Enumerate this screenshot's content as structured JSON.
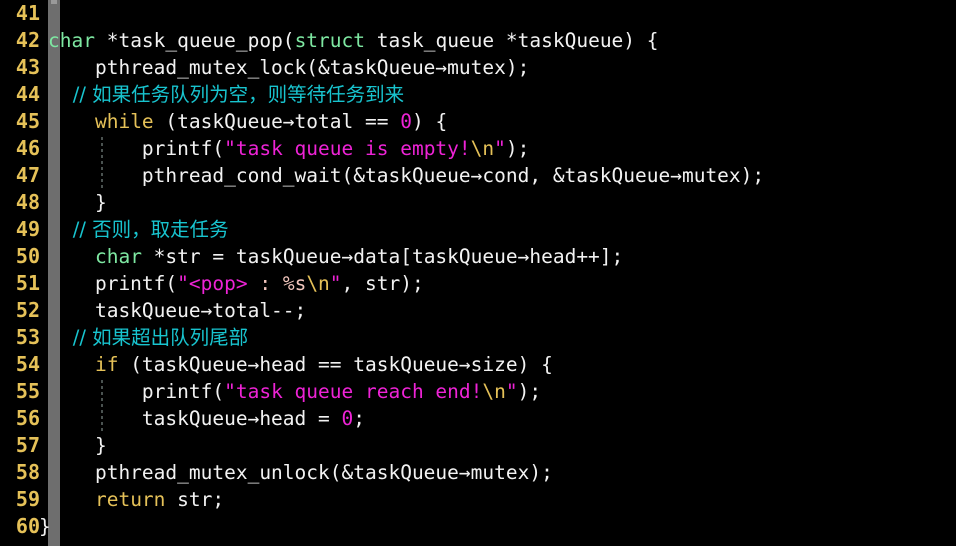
{
  "editor": {
    "background": "#000000",
    "first_line": 41,
    "last_line": 60,
    "gutter_color": "#e5c158",
    "scrollbar_color": "#6e6e6e",
    "colors": {
      "type_keyword": "#7ee8a2",
      "control_keyword": "#e5c158",
      "string": "#ee23d6",
      "escape": "#e5c158",
      "format_spec": "#f2c6bd",
      "number": "#ee23d6",
      "comment": "#18c4cf",
      "plain_text": "#f2f2f2"
    }
  },
  "line_numbers": [
    "41",
    "42",
    "43",
    "44",
    "45",
    "46",
    "47",
    "48",
    "49",
    "50",
    "51",
    "52",
    "53",
    "54",
    "55",
    "56",
    "57",
    "58",
    "59",
    "60"
  ],
  "code_lines": [
    {
      "num": "41",
      "text": ""
    },
    {
      "num": "42",
      "text": "char *task_queue_pop(struct task_queue *taskQueue) {"
    },
    {
      "num": "43",
      "text": "    pthread_mutex_lock(&taskQueue->mutex);"
    },
    {
      "num": "44",
      "text": "    // 如果任务队列为空，则等待任务到来"
    },
    {
      "num": "45",
      "text": "    while (taskQueue->total == 0) {"
    },
    {
      "num": "46",
      "text": "        printf(\"task queue is empty!\\n\");"
    },
    {
      "num": "47",
      "text": "        pthread_cond_wait(&taskQueue->cond, &taskQueue->mutex);"
    },
    {
      "num": "48",
      "text": "    }"
    },
    {
      "num": "49",
      "text": "    // 否则，取走任务"
    },
    {
      "num": "50",
      "text": "    char *str = taskQueue->data[taskQueue->head++];"
    },
    {
      "num": "51",
      "text": "    printf(\"<pop> : %s\\n\", str);"
    },
    {
      "num": "52",
      "text": "    taskQueue->total--;"
    },
    {
      "num": "53",
      "text": "    // 如果超出队列尾部"
    },
    {
      "num": "54",
      "text": "    if (taskQueue->head == taskQueue->size) {"
    },
    {
      "num": "55",
      "text": "        printf(\"task queue reach end!\\n\");"
    },
    {
      "num": "56",
      "text": "        taskQueue->head = 0;"
    },
    {
      "num": "57",
      "text": "    }"
    },
    {
      "num": "58",
      "text": "    pthread_mutex_unlock(&taskQueue->mutex);"
    },
    {
      "num": "59",
      "text": "    return str;"
    },
    {
      "num": "60",
      "text": "}"
    }
  ],
  "tokens": {
    "l42": {
      "t1": "char",
      "t2": " *task_queue_pop(",
      "t3": "struct",
      "t4": " task_queue *taskQueue) {"
    },
    "l43": {
      "t1": "    pthread_mutex_lock(&taskQueue→mutex);"
    },
    "l44": {
      "t1": "    // 如果任务队列为空，则等待任务到来"
    },
    "l45": {
      "t1": "    ",
      "t2": "while",
      "t3": " (taskQueue→total == ",
      "t4": "0",
      "t5": ") {"
    },
    "l46": {
      "t1": "        printf(",
      "t2": "\"task queue is empty!",
      "t3": "\\n",
      "t4": "\"",
      "t5": ");"
    },
    "l47": {
      "t1": "        pthread_cond_wait(&taskQueue→cond, &taskQueue→mutex);"
    },
    "l48": {
      "t1": "    }"
    },
    "l49": {
      "t1": "    // 否则，取走任务"
    },
    "l50": {
      "t1": "    ",
      "t2": "char",
      "t3": " *str = taskQueue→data[taskQueue→head++];"
    },
    "l51": {
      "t1": "    printf(",
      "t2": "\"<pop>",
      "t3": " : ",
      "t4": "%s",
      "t5": "\\n",
      "t6": "\"",
      "t7": ", str);"
    },
    "l52": {
      "t1": "    taskQueue→total--;"
    },
    "l53": {
      "t1": "    // 如果超出队列尾部"
    },
    "l54": {
      "t1": "    ",
      "t2": "if",
      "t3": " (taskQueue→head == taskQueue→size) {"
    },
    "l55": {
      "t1": "        printf(",
      "t2": "\"task queue reach end!",
      "t3": "\\n",
      "t4": "\"",
      "t5": ");"
    },
    "l56": {
      "t1": "        taskQueue→head = ",
      "t2": "0",
      "t3": ";"
    },
    "l57": {
      "t1": "    }"
    },
    "l58": {
      "t1": "    pthread_mutex_unlock(&taskQueue→mutex);"
    },
    "l59": {
      "t1": "    ",
      "t2": "return",
      "t3": " str;"
    },
    "l60": {
      "t1": "}"
    }
  }
}
